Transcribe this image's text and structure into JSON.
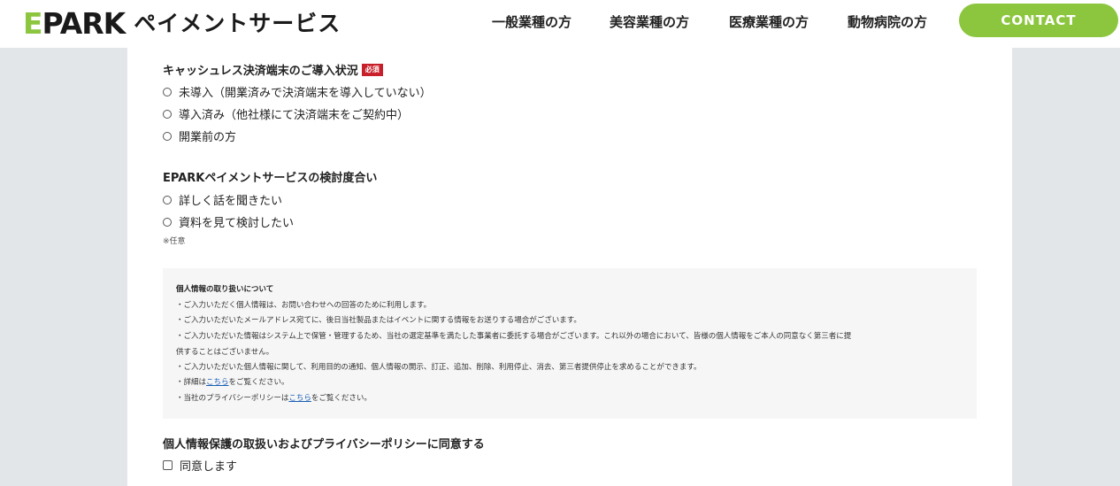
{
  "header": {
    "logo_main_e": "E",
    "logo_main_rest": "PARK",
    "logo_sub": "ペイメントサービス",
    "nav": [
      {
        "label": "一般業種の方"
      },
      {
        "label": "美容業種の方"
      },
      {
        "label": "医療業種の方"
      },
      {
        "label": "動物病院の方"
      }
    ],
    "contact_label": "CONTACT",
    "accent_color": "#8cc63f"
  },
  "form": {
    "q1": {
      "title": "キャッシュレス決済端末のご導入状況",
      "required_badge": "必須",
      "options": [
        {
          "label": "未導入（開業済みで決済端末を導入していない）"
        },
        {
          "label": "導入済み（他社様にて決済端末をご契約中）"
        },
        {
          "label": "開業前の方"
        }
      ]
    },
    "q2": {
      "title": "EPARKペイメントサービスの検討度合い",
      "options": [
        {
          "label": "詳しく話を聞きたい"
        },
        {
          "label": "資料を見て検討したい"
        }
      ],
      "note": "※任意"
    },
    "privacy": {
      "title": "個人情報の取り扱いについて",
      "lines": [
        "・ご入力いただく個人情報は、お問い合わせへの回答のために利用します。",
        "・ご入力いただいたメールアドレス宛てに、後日当社製品またはイベントに関する情報をお送りする場合がございます。",
        "・ご入力いただいた情報はシステム上で保管・管理するため、当社の選定基準を満たした事業者に委託する場合がございます。これ以外の場合において、皆様の個人情報をご本人の同意なく第三者に提",
        "供することはございません。",
        "・ご入力いただいた個人情報に関して、利用目的の通知、個人情報の開示、訂正、追加、削除、利用停止、消去、第三者提供停止を求めることができます。"
      ],
      "detail_prefix": "・詳細は",
      "detail_link": "こちら",
      "detail_suffix": "をご覧ください。",
      "policy_prefix": "・当社のプライバシーポリシーは",
      "policy_link": "こちら",
      "policy_suffix": "をご覧ください。"
    },
    "consent": {
      "title": "個人情報保護の取扱いおよびプライバシーポリシーに同意する",
      "checkbox_label": "同意します"
    }
  }
}
